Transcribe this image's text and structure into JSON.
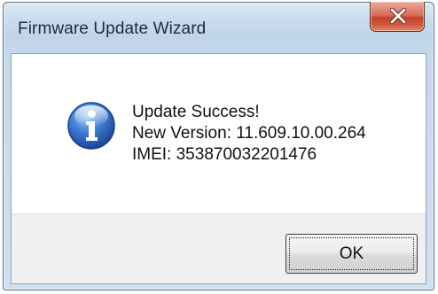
{
  "window": {
    "title": "Firmware Update Wizard",
    "close_icon": "close-x-icon"
  },
  "message": {
    "icon": "information-icon",
    "lines": [
      "Update Success!",
      "New Version: 11.609.10.00.264",
      "IMEI: 353870032201476"
    ]
  },
  "buttons": {
    "ok_label": "OK"
  },
  "colors": {
    "titlebar": "#c9dcee",
    "close_button": "#c4432c",
    "info_icon": "#2a62b8",
    "footer": "#f0f0f0"
  }
}
